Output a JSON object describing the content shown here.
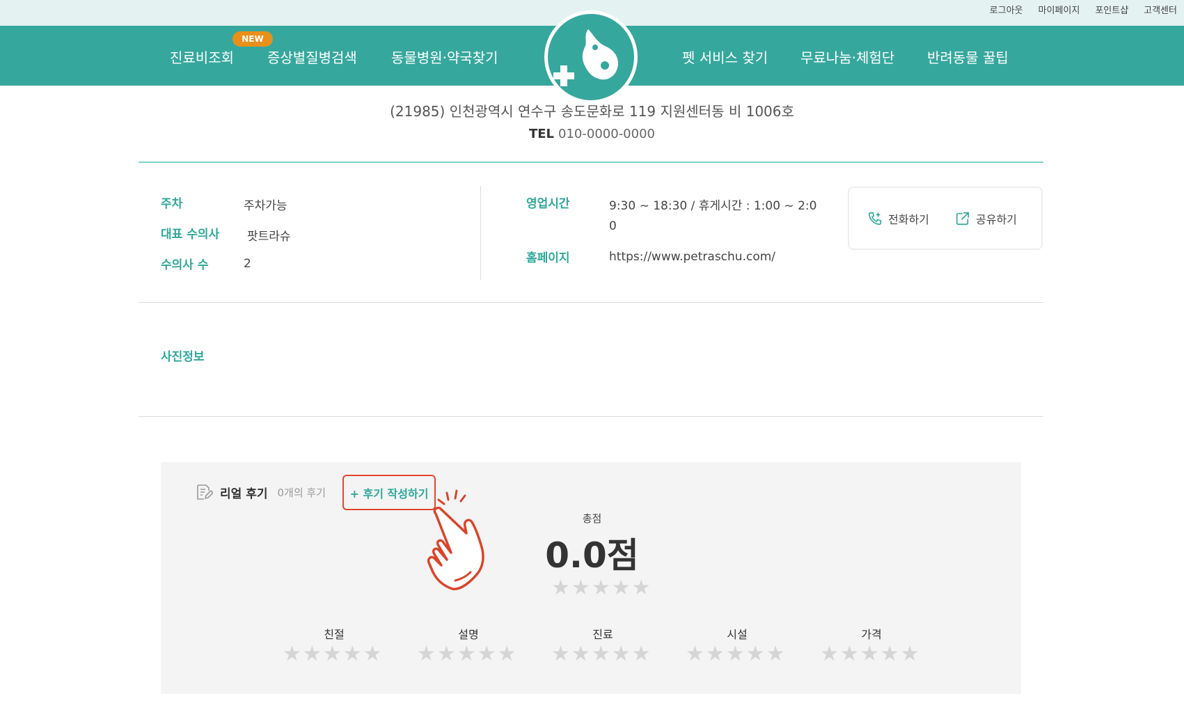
{
  "util_links": [
    "로그아웃",
    "마이페이지",
    "포인트샵",
    "고객센터"
  ],
  "nav": {
    "items": [
      "진료비조회",
      "증상별질병검색",
      "동물병원·약국찾기",
      "펫 서비스 찾기",
      "무료나눔·체험단",
      "반려동물 꿀팁"
    ],
    "new_badge": "NEW",
    "logo_icon": "pet-medical-logo-icon"
  },
  "hospital": {
    "address": "(21985) 인천광역시 연수구 송도문화로 119 지원센터동 비 1006호",
    "tel_label": "TEL",
    "tel": "010-0000-0000"
  },
  "info": {
    "parking_label": "주차",
    "parking_value": "주차가능",
    "vet_label": "대표 수의사",
    "vet_value": "팟트라슈",
    "vet_count_label": "수의사 수",
    "vet_count_value": "2",
    "hours_label": "영업시간",
    "hours_line1": "9:30 ~ 18:30 / 휴게시간 : 1:00 ~ 2:0",
    "hours_line2": "0",
    "homepage_label": "홈페이지",
    "homepage_value": "https://www.petraschu.com/"
  },
  "actions": {
    "call": "전화하기",
    "share": "공유하기"
  },
  "photos": {
    "title": "사진정보"
  },
  "review": {
    "title": "리얼 후기",
    "count": "0개의 후기",
    "write": "+ 후기 작성하기",
    "total_label": "총점",
    "total_score": "0.0점",
    "rating_value": 0,
    "categories": [
      "친절",
      "설명",
      "진료",
      "시설",
      "가격"
    ]
  },
  "colors": {
    "brand": "#36a79d",
    "accent": "#2fa79a",
    "badge": "#e8901c",
    "highlight": "#e0462c"
  }
}
